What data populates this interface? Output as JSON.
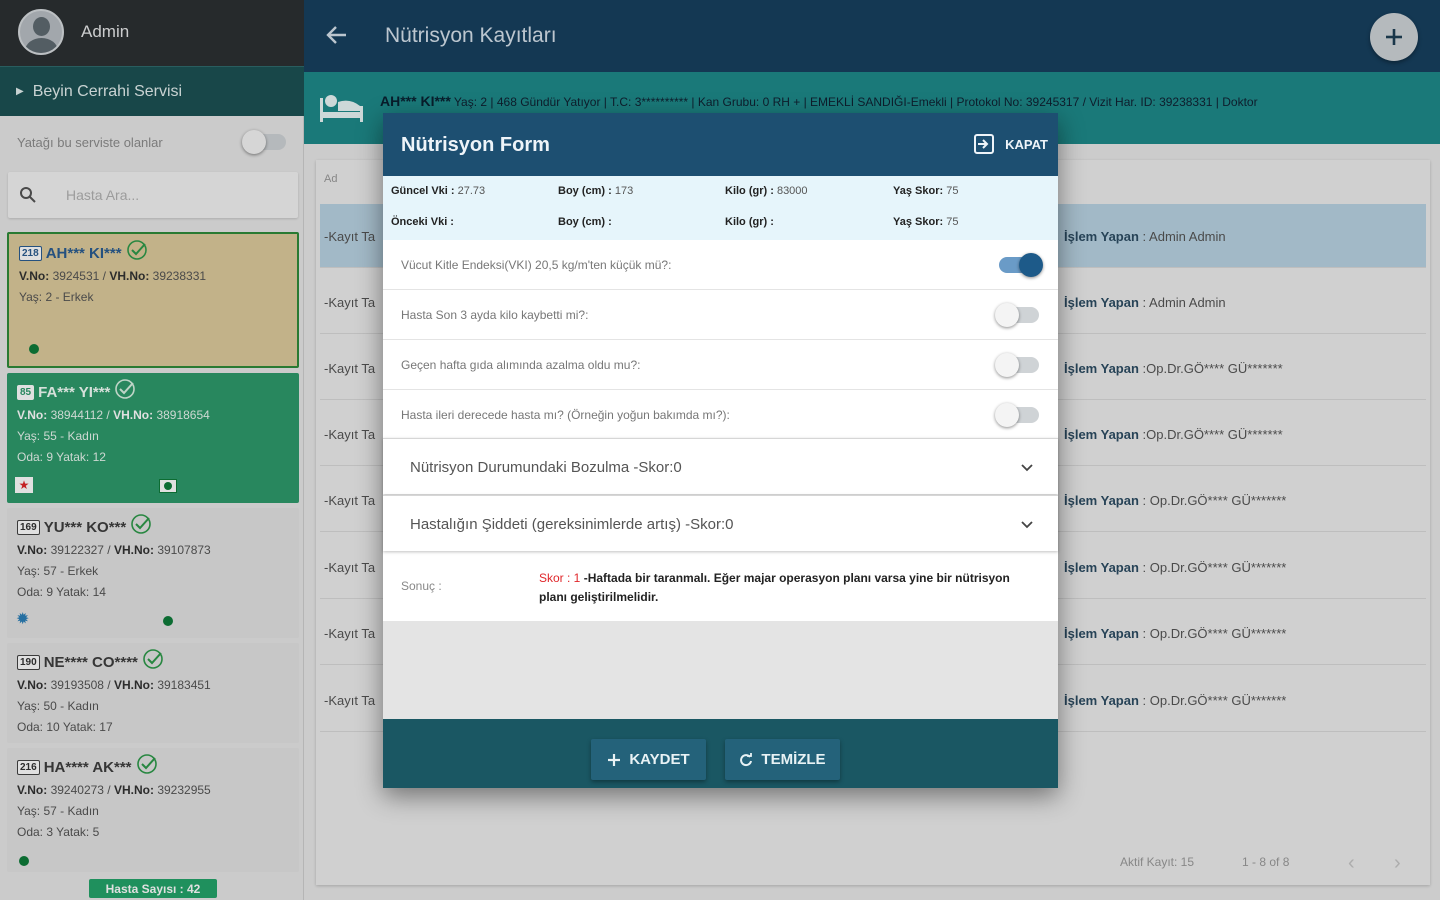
{
  "sidebar": {
    "user": "Admin",
    "service": "Beyin Cerrahi Servisi",
    "filter_label": "Yatağı bu serviste olanlar",
    "search_placeholder": "Hasta Ara...",
    "patients": [
      {
        "room": "218",
        "name": "AH*** KI***",
        "v_no": "3924531",
        "vh_no": "39238331",
        "line2": "Yaş: 2 - Erkek",
        "line3": ""
      },
      {
        "room": "85",
        "name": "FA*** YI***",
        "v_no": "38944112",
        "vh_no": "38918654",
        "line2": "Yaş: 55 - Kadın",
        "line3": "Oda: 9 Yatak: 12"
      },
      {
        "room": "169",
        "name": "YU*** KO***",
        "v_no": "39122327",
        "vh_no": "39107873",
        "line2": "Yaş: 57 - Erkek",
        "line3": "Oda: 9 Yatak: 14"
      },
      {
        "room": "190",
        "name": "NE**** CO****",
        "v_no": "39193508",
        "vh_no": "39183451",
        "line2": "Yaş: 50 - Kadın",
        "line3": "Oda: 10 Yatak: 17"
      },
      {
        "room": "216",
        "name": "HA**** AK***",
        "v_no": "39240273",
        "vh_no": "39232955",
        "line2": "Yaş: 57 - Kadın",
        "line3": "Oda: 3 Yatak: 5"
      }
    ],
    "v_label": "V.No:",
    "vh_label": "VH.No:",
    "patient_count": "Hasta Sayısı : 42"
  },
  "header": {
    "title": "Nütrisyon Kayıtları"
  },
  "info_bar": {
    "name": "AH*** KI***",
    "text": " Yaş: 2 | 468 Gündür Yatıyor | T.C: 3********** | Kan Grubu: 0 RH + | EMEKLİ SANDIĞI-Emekli | Protokol No: 39245317 / Vizit Har. ID: 39238331 | Doktor"
  },
  "list": {
    "label": "Ad",
    "rows": [
      {
        "left": "-Kayıt Ta",
        "right_label": "İşlem Yapan",
        "right_value": " : Admin Admin"
      },
      {
        "left": "-Kayıt Ta",
        "right_label": "İşlem Yapan",
        "right_value": " : Admin Admin"
      },
      {
        "left": "-Kayıt Ta",
        "right_label": "İşlem Yapan",
        "right_value": " :Op.Dr.GÖ**** GÜ*******"
      },
      {
        "left": "-Kayıt Ta",
        "right_label": "İşlem Yapan",
        "right_value": " :Op.Dr.GÖ**** GÜ*******"
      },
      {
        "left": "-Kayıt Ta",
        "right_label": "İşlem Yapan",
        "right_value": " : Op.Dr.GÖ**** GÜ*******"
      },
      {
        "left": "-Kayıt Ta",
        "right_label": "İşlem Yapan",
        "right_value": " : Op.Dr.GÖ**** GÜ*******"
      },
      {
        "left": "-Kayıt Ta",
        "right_label": "İşlem Yapan",
        "right_value": " : Op.Dr.GÖ**** GÜ*******"
      },
      {
        "left": "-Kayıt Ta",
        "right_label": "İşlem Yapan",
        "right_value": " : Op.Dr.GÖ**** GÜ*******"
      }
    ],
    "active_count": "Aktif Kayıt: 15",
    "page_range": "1 - 8 of 8"
  },
  "modal": {
    "title": "Nütrisyon Form",
    "close_label": "KAPAT",
    "metrics": {
      "row1": [
        {
          "label": "Güncel Vki :",
          "value": " 27.73"
        },
        {
          "label": "Boy (cm) :",
          "value": " 173"
        },
        {
          "label": "Kilo (gr) :",
          "value": " 83000"
        },
        {
          "label": "Yaş Skor:",
          "value": " 75"
        }
      ],
      "row2": [
        {
          "label": "Önceki Vki :",
          "value": ""
        },
        {
          "label": "Boy (cm) :",
          "value": ""
        },
        {
          "label": "Kilo (gr) :",
          "value": ""
        },
        {
          "label": "Yaş Skor:",
          "value": " 75"
        }
      ]
    },
    "questions": [
      {
        "text": "Vücut Kitle Endeksi(VKI) 20,5 kg/m'ten küçük mü?:",
        "on": true
      },
      {
        "text": "Hasta Son 3 ayda kilo kaybetti mi?:",
        "on": false
      },
      {
        "text": "Geçen hafta gıda alımında azalma oldu mu?:",
        "on": false
      },
      {
        "text": "Hasta ileri derecede hasta mı? (Örneğin yoğun bakımda mı?):",
        "on": false
      }
    ],
    "accordions": [
      "Nütrisyon Durumundaki Bozulma -Skor:0",
      "Hastalığın Şiddeti (gereksinimlerde artış) -Skor:0"
    ],
    "result_label": "Sonuç :",
    "result_score": "Skor : 1",
    "result_text": " -Haftada bir taranmalı. Eğer majar operasyon planı varsa yine bir nütrisyon planı geliştirilmelidir.",
    "save_label": "KAYDET",
    "clear_label": "TEMİZLE"
  },
  "colors": {
    "topbar": "#17405f",
    "info_bar": "#1e8a8a",
    "modal_head": "#1d4f71",
    "modal_foot": "#1a5763",
    "accent_red": "#e0262a",
    "patient_green": "#2e9a6b"
  }
}
